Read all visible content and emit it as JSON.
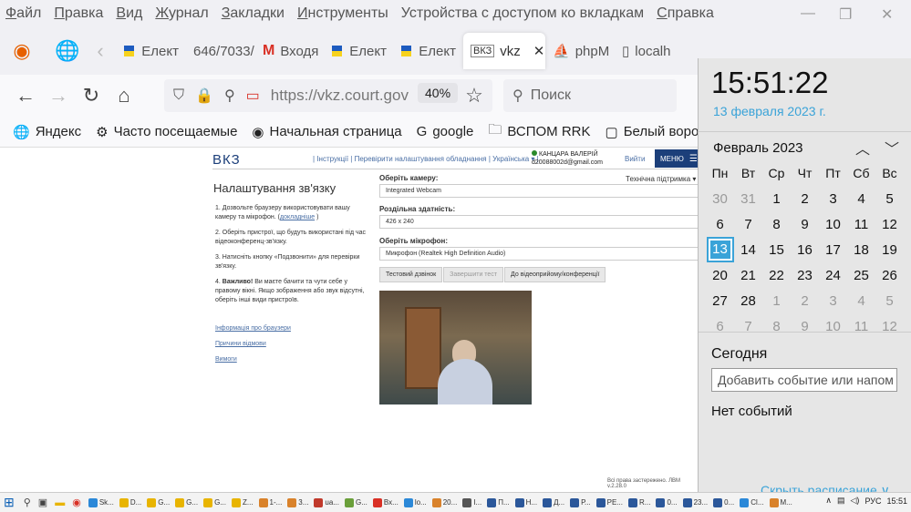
{
  "menubar": {
    "items": [
      {
        "u": "Ф",
        "rest": "айл"
      },
      {
        "u": "П",
        "rest": "равка"
      },
      {
        "u": "В",
        "rest": "ид"
      },
      {
        "u": "Ж",
        "rest": "урнал"
      },
      {
        "u": "З",
        "rest": "акладки"
      },
      {
        "u": "И",
        "rest": "нструменты"
      },
      {
        "u": "",
        "rest": "Устройства с доступом ко вкладкам"
      },
      {
        "u": "С",
        "rest": "правка"
      }
    ]
  },
  "tabs": [
    {
      "label": "Елект",
      "icon": "flag"
    },
    {
      "label": "646/7033/",
      "icon": "none"
    },
    {
      "label": "Входя",
      "icon": "gmail"
    },
    {
      "label": "Елект",
      "icon": "flag"
    },
    {
      "label": "Елект",
      "icon": "flag"
    },
    {
      "label": "vkz",
      "icon": "vkz",
      "active": true
    },
    {
      "label": "phpM",
      "icon": "php"
    },
    {
      "label": "localh",
      "icon": "page"
    }
  ],
  "nav": {
    "url": "https://vkz.court.gov",
    "zoom": "40%",
    "search_placeholder": "Поиск"
  },
  "bookmarks": [
    {
      "label": "Яндекс",
      "icon": "🌐"
    },
    {
      "label": "Часто посещаемые",
      "icon": "⚙"
    },
    {
      "label": "Начальная страница",
      "icon": "◉"
    },
    {
      "label": "google",
      "icon": "G"
    },
    {
      "label": "ВСПОМ RRK",
      "icon": "🗀"
    },
    {
      "label": "Белый воротничо",
      "icon": "▢"
    }
  ],
  "site": {
    "logo": "ВКЗ",
    "toplinks": "|  Інструкції  |  Перевірити налаштування обладнання  |  Українська ▾  |",
    "user_name": "КАНЦАРА ВАЛЕРІЙ",
    "user_email": "d20088002d@gmail.com",
    "logout": "Вийти",
    "menu_label": "МЕНЮ",
    "title": "Налаштування зв'язку",
    "support": "Технічна підтримка ▾",
    "steps": [
      {
        "num": "1.",
        "text": "Дозвольте браузеру використовувати вашу камеру та мікрофон. (",
        "link": "докладніше",
        "after": " )"
      },
      {
        "num": "2.",
        "text": "Оберіть пристрої, що будуть використані під час відеоконференц-зв'язку.",
        "link": "",
        "after": ""
      },
      {
        "num": "3.",
        "text": "Натисніть кнопку «Подзвонити» для перевірки зв'язку.",
        "link": "",
        "after": ""
      },
      {
        "num": "4.",
        "text": "Ви маєте бачити та чути себе у правому вікні. Якщо зображення або звук відсутні, оберіть інші види пристроїв.",
        "bold": "Важливо!",
        "link": "",
        "after": ""
      }
    ],
    "side_links": [
      "Інформація про браузери",
      "Причини відмови",
      "Вимоги"
    ],
    "camera_label": "Оберіть камеру:",
    "camera_value": "Integrated Webcam",
    "resolution_label": "Роздільна здатність:",
    "resolution_value": "426 x 240",
    "mic_label": "Оберіть мікрофон:",
    "mic_value": "Микрофон (Realtek High Definition Audio)",
    "btn_test": "Тестовий дзвінок",
    "btn_end": "Завершити тест",
    "btn_conf": "До відеоприйому/конференції",
    "copyright": "Всі права застережено. ЛВМ v.2.28.0"
  },
  "calendar": {
    "time": "15:51:22",
    "date": "13 февраля 2023 г.",
    "month": "Февраль 2023",
    "weekdays": [
      "Пн",
      "Вт",
      "Ср",
      "Чт",
      "Пт",
      "Сб",
      "Вс"
    ],
    "weeks": [
      [
        "30",
        "31",
        "1",
        "2",
        "3",
        "4",
        "5"
      ],
      [
        "6",
        "7",
        "8",
        "9",
        "10",
        "11",
        "12"
      ],
      [
        "13",
        "14",
        "15",
        "16",
        "17",
        "18",
        "19"
      ],
      [
        "20",
        "21",
        "22",
        "23",
        "24",
        "25",
        "26"
      ],
      [
        "27",
        "28",
        "1",
        "2",
        "3",
        "4",
        "5"
      ],
      [
        "6",
        "7",
        "8",
        "9",
        "10",
        "11",
        "12"
      ]
    ],
    "today_label": "Сегодня",
    "event_placeholder": "Добавить событие или напом",
    "no_events": "Нет событий",
    "hide_schedule": "Скрыть расписание ∨"
  },
  "taskbar": {
    "items": [
      {
        "label": "Sk...",
        "color": "#2b88d8"
      },
      {
        "label": "D...",
        "color": "#e8b400"
      },
      {
        "label": "G...",
        "color": "#e8b400"
      },
      {
        "label": "G...",
        "color": "#e8b400"
      },
      {
        "label": "G...",
        "color": "#e8b400"
      },
      {
        "label": "Z...",
        "color": "#e8b400"
      },
      {
        "label": "1-...",
        "color": "#d9822b"
      },
      {
        "label": "3...",
        "color": "#d9822b"
      },
      {
        "label": "ua...",
        "color": "#c0392b"
      },
      {
        "label": "G...",
        "color": "#6a9f3a"
      },
      {
        "label": "Вх...",
        "color": "#d93025"
      },
      {
        "label": "lo...",
        "color": "#2b88d8"
      },
      {
        "label": "20...",
        "color": "#d9822b"
      },
      {
        "label": "I...",
        "color": "#555555"
      },
      {
        "label": "П...",
        "color": "#2b579a"
      },
      {
        "label": "Н...",
        "color": "#2b579a"
      },
      {
        "label": "Д...",
        "color": "#2b579a"
      },
      {
        "label": "Р...",
        "color": "#2b579a"
      },
      {
        "label": "РЕ...",
        "color": "#2b579a"
      },
      {
        "label": "R...",
        "color": "#2b579a"
      },
      {
        "label": "0...",
        "color": "#2b579a"
      },
      {
        "label": "23...",
        "color": "#2b579a"
      },
      {
        "label": "0...",
        "color": "#2b579a"
      },
      {
        "label": "Cl...",
        "color": "#2b88d8"
      },
      {
        "label": "M...",
        "color": "#d9822b"
      }
    ],
    "lang": "РУС",
    "clock": "15:51"
  }
}
